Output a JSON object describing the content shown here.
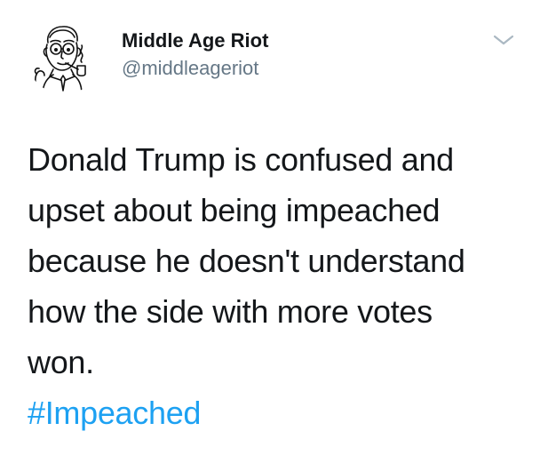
{
  "author": {
    "name": "Middle Age Riot",
    "handle": "@middleageriot",
    "avatar_icon": "cartoon-man-with-pipe-icon"
  },
  "tweet": {
    "lines": [
      "Donald Trump is confused and",
      "upset about being impeached",
      "because he doesn't understand",
      "how the side with more votes",
      "won."
    ],
    "hashtag": "#Impeached"
  },
  "menu": {
    "icon": "chevron-down-icon"
  },
  "colors": {
    "text": "#14171a",
    "secondary_text": "#657786",
    "link": "#1da1f2",
    "caret": "#aab8c2"
  }
}
